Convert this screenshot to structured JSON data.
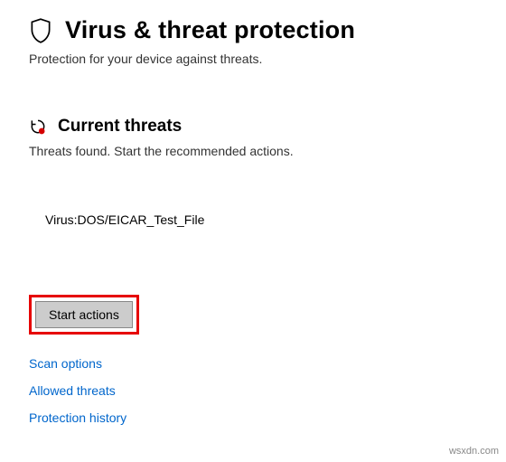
{
  "header": {
    "title": "Virus & threat protection",
    "subtitle": "Protection for your device against threats."
  },
  "currentThreats": {
    "title": "Current threats",
    "subtitle": "Threats found. Start the recommended actions.",
    "threatName": "Virus:DOS/EICAR_Test_File",
    "startActionsLabel": "Start actions"
  },
  "links": {
    "scanOptions": "Scan options",
    "allowedThreats": "Allowed threats",
    "protectionHistory": "Protection history"
  },
  "watermark": "wsxdn.com"
}
